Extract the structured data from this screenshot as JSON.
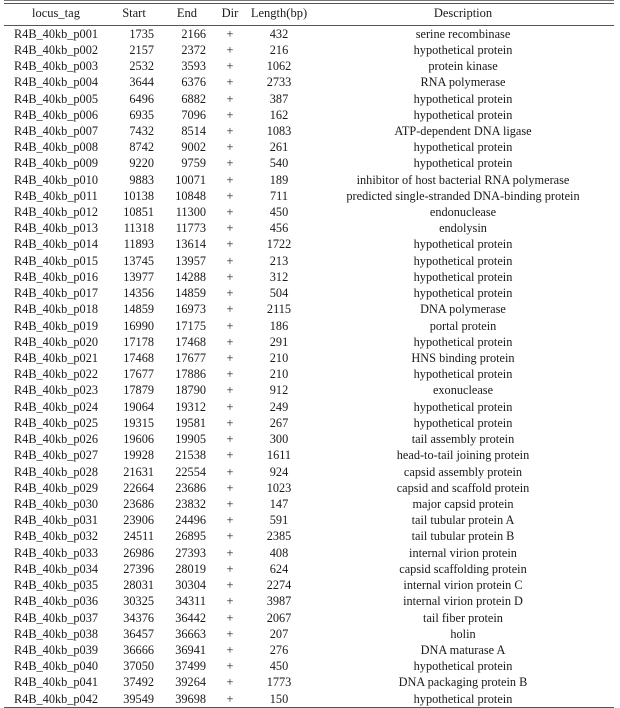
{
  "table": {
    "columns": [
      {
        "key": "locus_tag",
        "label": "locus_tag"
      },
      {
        "key": "start",
        "label": "Start"
      },
      {
        "key": "end",
        "label": "End"
      },
      {
        "key": "dir",
        "label": "Dir"
      },
      {
        "key": "length",
        "label": "Length(bp)"
      },
      {
        "key": "description",
        "label": "Description"
      }
    ],
    "rows": [
      {
        "locus_tag": "R4B_40kb_p001",
        "start": "1735",
        "end": "2166",
        "dir": "+",
        "length": "432",
        "description": "serine  recombinase"
      },
      {
        "locus_tag": "R4B_40kb_p002",
        "start": "2157",
        "end": "2372",
        "dir": "+",
        "length": "216",
        "description": "hypothetical  protein"
      },
      {
        "locus_tag": "R4B_40kb_p003",
        "start": "2532",
        "end": "3593",
        "dir": "+",
        "length": "1062",
        "description": "protein kinase"
      },
      {
        "locus_tag": "R4B_40kb_p004",
        "start": "3644",
        "end": "6376",
        "dir": "+",
        "length": "2733",
        "description": "RNA  polymerase"
      },
      {
        "locus_tag": "R4B_40kb_p005",
        "start": "6496",
        "end": "6882",
        "dir": "+",
        "length": "387",
        "description": "hypothetical  protein"
      },
      {
        "locus_tag": "R4B_40kb_p006",
        "start": "6935",
        "end": "7096",
        "dir": "+",
        "length": "162",
        "description": "hypothetical  protein"
      },
      {
        "locus_tag": "R4B_40kb_p007",
        "start": "7432",
        "end": "8514",
        "dir": "+",
        "length": "1083",
        "description": "ATP-dependent DNA   ligase"
      },
      {
        "locus_tag": "R4B_40kb_p008",
        "start": "8742",
        "end": "9002",
        "dir": "+",
        "length": "261",
        "description": "hypothetical  protein"
      },
      {
        "locus_tag": "R4B_40kb_p009",
        "start": "9220",
        "end": "9759",
        "dir": "+",
        "length": "540",
        "description": "hypothetical  protein"
      },
      {
        "locus_tag": "R4B_40kb_p010",
        "start": "9883",
        "end": "10071",
        "dir": "+",
        "length": "189",
        "description": "inhibitor of host   bacterial RNA  polymerase"
      },
      {
        "locus_tag": "R4B_40kb_p011",
        "start": "10138",
        "end": "10848",
        "dir": "+",
        "length": "711",
        "description": "predicted   single-stranded  DNA-binding  protein"
      },
      {
        "locus_tag": "R4B_40kb_p012",
        "start": "10851",
        "end": "11300",
        "dir": "+",
        "length": "450",
        "description": "endonuclease"
      },
      {
        "locus_tag": "R4B_40kb_p013",
        "start": "11318",
        "end": "11773",
        "dir": "+",
        "length": "456",
        "description": "endolysin"
      },
      {
        "locus_tag": "R4B_40kb_p014",
        "start": "11893",
        "end": "13614",
        "dir": "+",
        "length": "1722",
        "description": "hypothetical  protein"
      },
      {
        "locus_tag": "R4B_40kb_p015",
        "start": "13745",
        "end": "13957",
        "dir": "+",
        "length": "213",
        "description": "hypothetical  protein"
      },
      {
        "locus_tag": "R4B_40kb_p016",
        "start": "13977",
        "end": "14288",
        "dir": "+",
        "length": "312",
        "description": "hypothetical  protein"
      },
      {
        "locus_tag": "R4B_40kb_p017",
        "start": "14356",
        "end": "14859",
        "dir": "+",
        "length": "504",
        "description": "hypothetical  protein"
      },
      {
        "locus_tag": "R4B_40kb_p018",
        "start": "14859",
        "end": "16973",
        "dir": "+",
        "length": "2115",
        "description": "DNA  polymerase"
      },
      {
        "locus_tag": "R4B_40kb_p019",
        "start": "16990",
        "end": "17175",
        "dir": "+",
        "length": "186",
        "description": "portal protein"
      },
      {
        "locus_tag": "R4B_40kb_p020",
        "start": "17178",
        "end": "17468",
        "dir": "+",
        "length": "291",
        "description": "hypothetical  protein"
      },
      {
        "locus_tag": "R4B_40kb_p021",
        "start": "17468",
        "end": "17677",
        "dir": "+",
        "length": "210",
        "description": "HNS  binding  protein"
      },
      {
        "locus_tag": "R4B_40kb_p022",
        "start": "17677",
        "end": "17886",
        "dir": "+",
        "length": "210",
        "description": "hypothetical  protein"
      },
      {
        "locus_tag": "R4B_40kb_p023",
        "start": "17879",
        "end": "18790",
        "dir": "+",
        "length": "912",
        "description": "exonuclease"
      },
      {
        "locus_tag": "R4B_40kb_p024",
        "start": "19064",
        "end": "19312",
        "dir": "+",
        "length": "249",
        "description": "hypothetical  protein"
      },
      {
        "locus_tag": "R4B_40kb_p025",
        "start": "19315",
        "end": "19581",
        "dir": "+",
        "length": "267",
        "description": "hypothetical  protein"
      },
      {
        "locus_tag": "R4B_40kb_p026",
        "start": "19606",
        "end": "19905",
        "dir": "+",
        "length": "300",
        "description": "tail assembly  protein"
      },
      {
        "locus_tag": "R4B_40kb_p027",
        "start": "19928",
        "end": "21538",
        "dir": "+",
        "length": "1611",
        "description": "head-to-tail joining   protein"
      },
      {
        "locus_tag": "R4B_40kb_p028",
        "start": "21631",
        "end": "22554",
        "dir": "+",
        "length": "924",
        "description": "capsid assembly   protein"
      },
      {
        "locus_tag": "R4B_40kb_p029",
        "start": "22664",
        "end": "23686",
        "dir": "+",
        "length": "1023",
        "description": "capsid and scaffold   protein"
      },
      {
        "locus_tag": "R4B_40kb_p030",
        "start": "23686",
        "end": "23832",
        "dir": "+",
        "length": "147",
        "description": "major capsid protein"
      },
      {
        "locus_tag": "R4B_40kb_p031",
        "start": "23906",
        "end": "24496",
        "dir": "+",
        "length": "591",
        "description": "tail tubular protein   A"
      },
      {
        "locus_tag": "R4B_40kb_p032",
        "start": "24511",
        "end": "26895",
        "dir": "+",
        "length": "2385",
        "description": "tail tubular protein   B"
      },
      {
        "locus_tag": "R4B_40kb_p033",
        "start": "26986",
        "end": "27393",
        "dir": "+",
        "length": "408",
        "description": "internal virion   protein"
      },
      {
        "locus_tag": "R4B_40kb_p034",
        "start": "27396",
        "end": "28019",
        "dir": "+",
        "length": "624",
        "description": "capsid scaffolding   protein"
      },
      {
        "locus_tag": "R4B_40kb_p035",
        "start": "28031",
        "end": "30304",
        "dir": "+",
        "length": "2274",
        "description": "internal virion   protein C"
      },
      {
        "locus_tag": "R4B_40kb_p036",
        "start": "30325",
        "end": "34311",
        "dir": "+",
        "length": "3987",
        "description": "internal virion   protein D"
      },
      {
        "locus_tag": "R4B_40kb_p037",
        "start": "34376",
        "end": "36442",
        "dir": "+",
        "length": "2067",
        "description": "tail fiber protein"
      },
      {
        "locus_tag": "R4B_40kb_p038",
        "start": "36457",
        "end": "36663",
        "dir": "+",
        "length": "207",
        "description": "holin"
      },
      {
        "locus_tag": "R4B_40kb_p039",
        "start": "36666",
        "end": "36941",
        "dir": "+",
        "length": "276",
        "description": "DNA  maturase A"
      },
      {
        "locus_tag": "R4B_40kb_p040",
        "start": "37050",
        "end": "37499",
        "dir": "+",
        "length": "450",
        "description": "hypothetical  protein"
      },
      {
        "locus_tag": "R4B_40kb_p041",
        "start": "37492",
        "end": "39264",
        "dir": "+",
        "length": "1773",
        "description": "DNA  packaging protein   B"
      },
      {
        "locus_tag": "R4B_40kb_p042",
        "start": "39549",
        "end": "39698",
        "dir": "+",
        "length": "150",
        "description": "hypothetical  protein"
      }
    ]
  }
}
